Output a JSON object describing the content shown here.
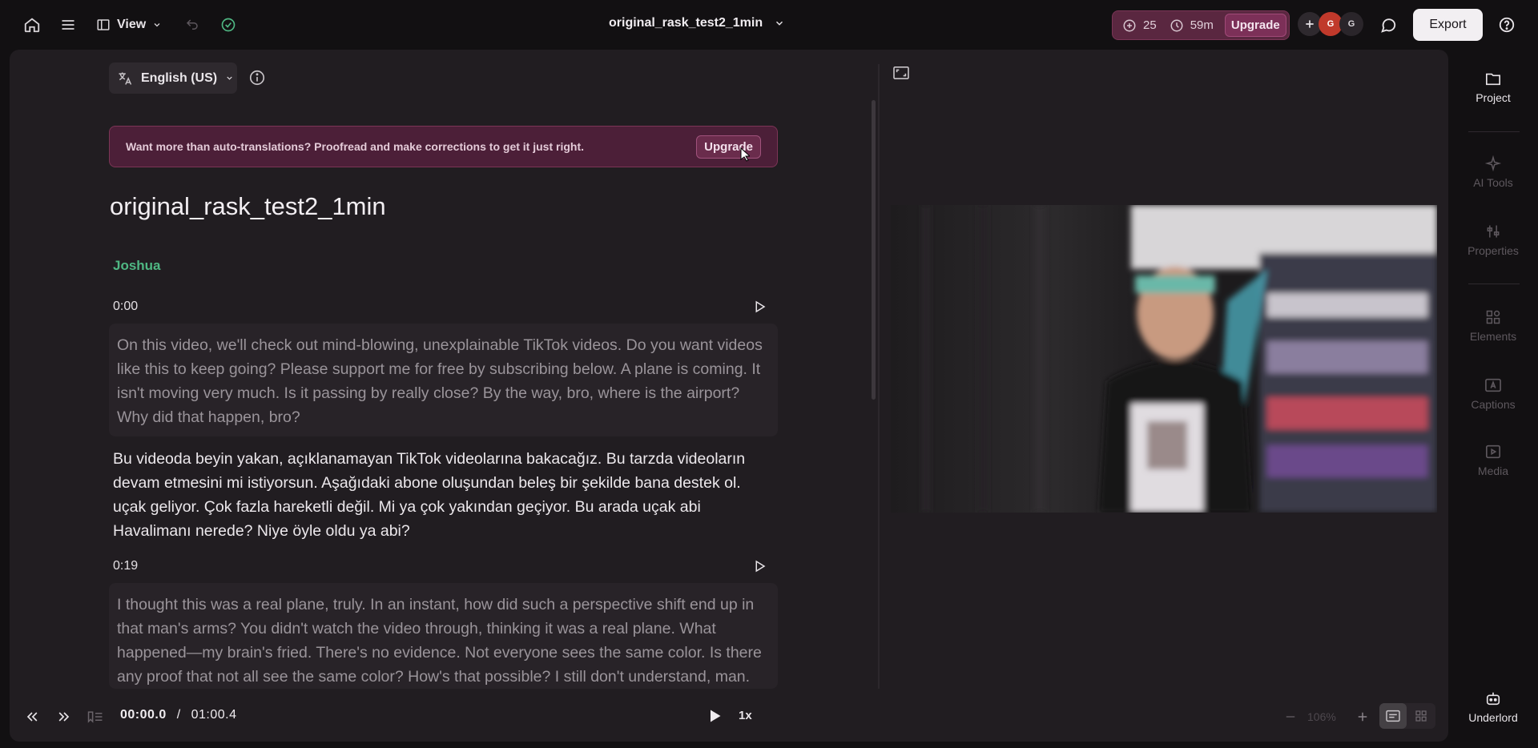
{
  "topbar": {
    "view_label": "View",
    "doc_title": "original_rask_test2_1min",
    "credits_count": "25",
    "credits_time": "59m",
    "upgrade_label": "Upgrade",
    "avatar_1": "G",
    "avatar_2": "G",
    "export_label": "Export"
  },
  "transcript": {
    "language": "English (US)",
    "banner_text": "Want more than auto-translations? Proofread and make corrections to get it just right.",
    "banner_upgrade": "Upgrade",
    "title": "original_rask_test2_1min",
    "speaker": "Joshua",
    "segments": [
      {
        "time": "0:00",
        "original": "On this video, we'll check out mind-blowing, unexplainable TikTok videos. Do you want videos like this to keep going? Please support me for free by subscribing below. A plane is coming. It isn't moving very much. Is it passing by really close? By the way, bro, where is the airport? Why did that happen, bro?",
        "translation": "Bu videoda beyin yakan, açıklanamayan TikTok videolarına bakacağız. Bu tarzda videoların devam etmesini mi istiyorsun. Aşağıdaki abone oluşundan beleş bir şekilde bana destek ol. uçak geliyor. Çok fazla hareketli değil. Mi ya çok yakından geçiyor. Bu arada uçak abi Havalimanı nerede? Niye öyle oldu ya abi?"
      },
      {
        "time": "0:19",
        "original": "I thought this was a real plane, truly. In an instant, how did such a perspective shift end up in that man's arms? You didn't watch the video through, thinking it was a real plane. What happened—my brain's fried. There's no evidence. Not everyone sees the same color. Is there any proof that not all see the same color? How's that possible? I still don't understand, man."
      }
    ]
  },
  "player": {
    "current_time": "00:00.0",
    "separator": "/",
    "total_time": "01:00.4",
    "speed": "1x",
    "zoom": "106%"
  },
  "sidebar": {
    "items": [
      {
        "label": "Project",
        "icon": "folder-icon"
      },
      {
        "label": "AI Tools",
        "icon": "sparkle-icon"
      },
      {
        "label": "Properties",
        "icon": "sliders-icon"
      },
      {
        "label": "Elements",
        "icon": "shapes-icon"
      },
      {
        "label": "Captions",
        "icon": "captions-icon"
      },
      {
        "label": "Media",
        "icon": "media-icon"
      }
    ],
    "underlord": "Underlord"
  },
  "colors": {
    "accent_green": "#4fb783",
    "upgrade_bg": "#5a2740",
    "panel_bg": "#211d21"
  }
}
